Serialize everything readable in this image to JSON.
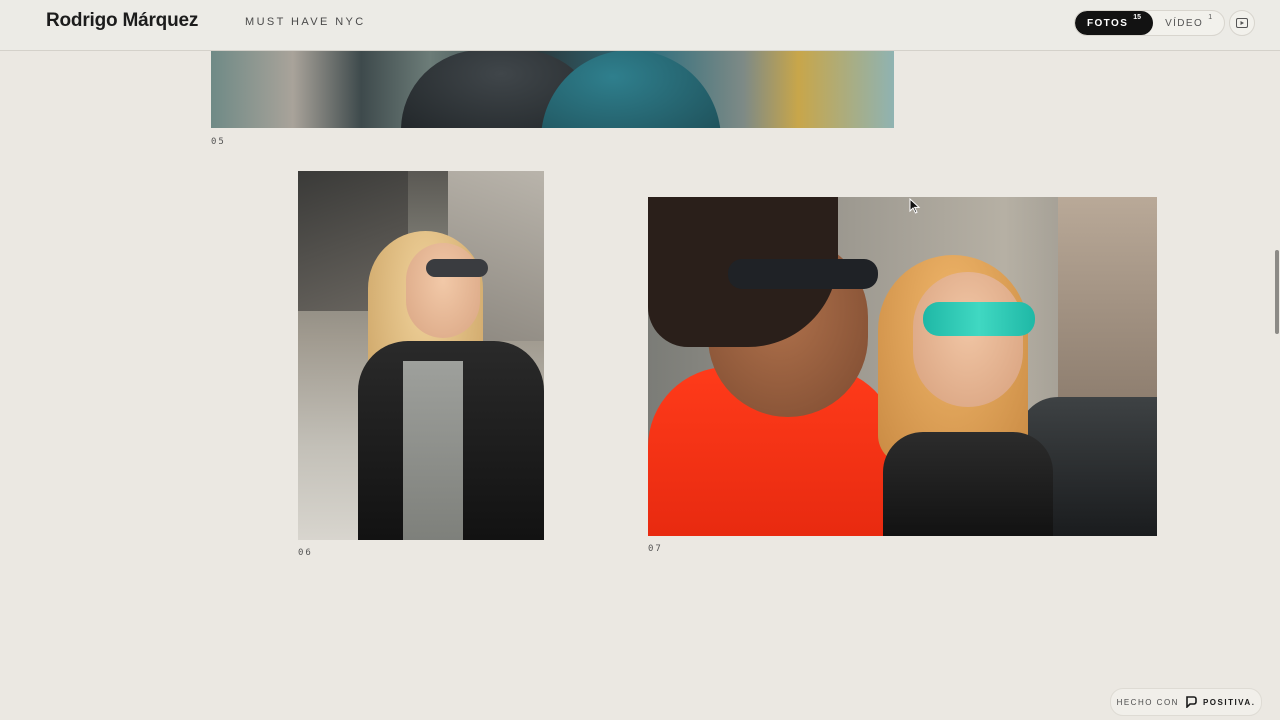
{
  "header": {
    "brand": "Rodrigo Márquez",
    "project": "MUST HAVE NYC",
    "tabs": [
      {
        "label": "FOTOS",
        "count": "15",
        "active": true
      },
      {
        "label": "VÍDEO",
        "count": "1",
        "active": false
      }
    ],
    "play_icon": "play-square-icon"
  },
  "gallery": {
    "items": [
      {
        "caption": "05"
      },
      {
        "caption": "06"
      },
      {
        "caption": "07"
      }
    ]
  },
  "footer": {
    "made_with": "HECHO CON",
    "platform": "POSITIVA."
  },
  "colors": {
    "background": "#ebe8e2",
    "active_tab": "#121212"
  }
}
